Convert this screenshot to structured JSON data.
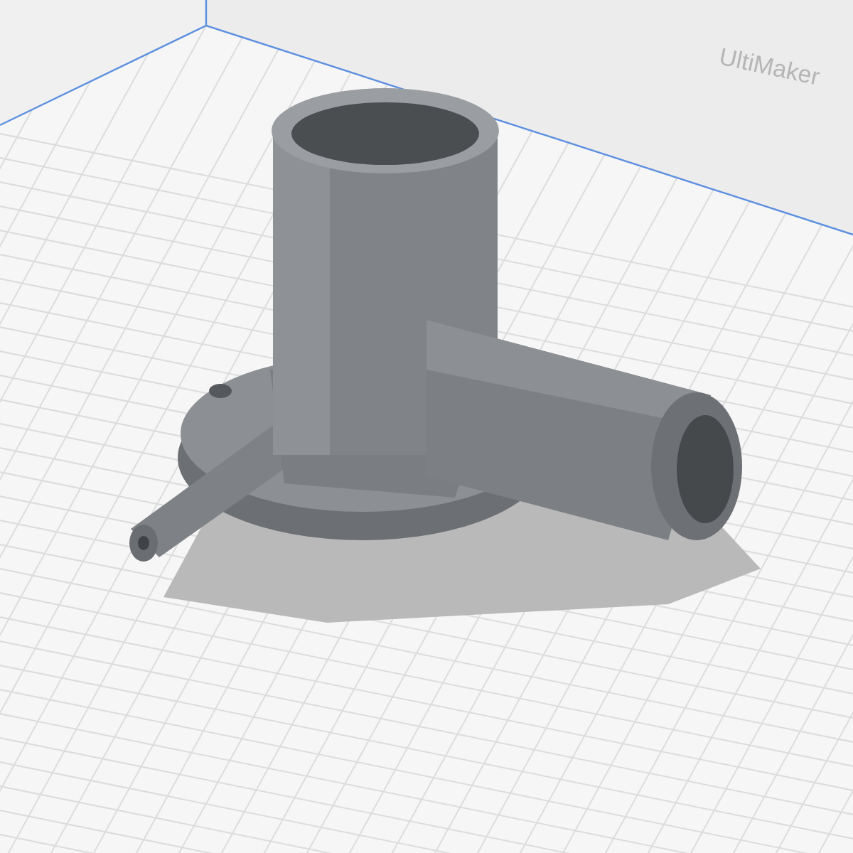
{
  "viewport": {
    "wall_logo": "UltiMaker"
  }
}
